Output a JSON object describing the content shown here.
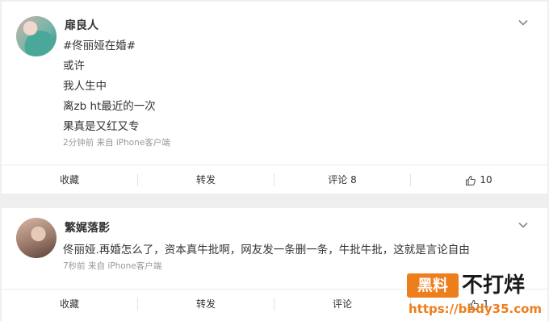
{
  "posts": [
    {
      "username": "扉良人",
      "content": [
        "#佟丽娅在婚#",
        "或许",
        "我人生中",
        "离zb ht最近的一次",
        "果真是又红又专"
      ],
      "meta": "2分钟前  来自 iPhone客户端",
      "actions": {
        "collect": "收藏",
        "repost": "转发",
        "comment": "评论 8",
        "like": "10"
      }
    },
    {
      "username": "繁娓落影",
      "content": [
        "佟丽娅.再婚怎么了，资本真牛批啊，网友发一条删一条，牛批牛批，这就是言论自由"
      ],
      "meta": "7秒前  来自 iPhone客户端",
      "actions": {
        "collect": "收藏",
        "repost": "转发",
        "comment": "评论",
        "like": "1"
      }
    }
  ],
  "watermark": {
    "box": "黑料",
    "title": "不打烊",
    "url": "https://bbdy35.com"
  },
  "colors": {
    "accent": "#ee7d1c",
    "background": "#efefef"
  }
}
